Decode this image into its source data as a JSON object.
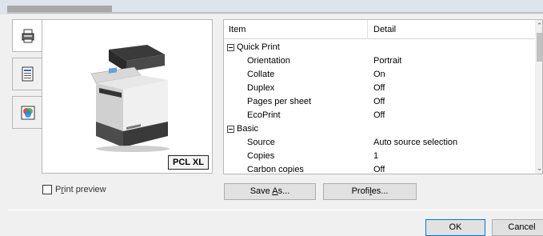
{
  "tabs": {
    "items": [
      {
        "icon": "printer-settings-icon"
      },
      {
        "icon": "page-layout-icon"
      },
      {
        "icon": "color-icon"
      }
    ]
  },
  "preview": {
    "pdl_badge": "PCL XL"
  },
  "grid": {
    "headers": {
      "item": "Item",
      "detail": "Detail"
    },
    "rows": [
      {
        "type": "group",
        "item": "Quick Print",
        "detail": ""
      },
      {
        "type": "prop",
        "item": "Orientation",
        "detail": "Portrait"
      },
      {
        "type": "prop",
        "item": "Collate",
        "detail": "On"
      },
      {
        "type": "prop",
        "item": "Duplex",
        "detail": "Off"
      },
      {
        "type": "prop",
        "item": "Pages per sheet",
        "detail": "Off"
      },
      {
        "type": "prop",
        "item": "EcoPrint",
        "detail": "Off"
      },
      {
        "type": "group",
        "item": "Basic",
        "detail": ""
      },
      {
        "type": "prop",
        "item": "Source",
        "detail": "Auto source selection"
      },
      {
        "type": "prop",
        "item": "Copies",
        "detail": "1"
      },
      {
        "type": "prop",
        "item": "Carbon copies",
        "detail": "Off"
      }
    ]
  },
  "print_preview": {
    "label_pre": "P",
    "label_underline": "r",
    "label_post": "int preview",
    "checked": false
  },
  "buttons": {
    "save_pre": "Save ",
    "save_underline": "A",
    "save_post": "s...",
    "profiles_pre": "Profi",
    "profiles_underline": "l",
    "profiles_post": "es...",
    "ok": "OK",
    "cancel": "Cancel"
  },
  "colors": {
    "accent": "#0078d7",
    "panel_border": "#b8b8b8"
  }
}
